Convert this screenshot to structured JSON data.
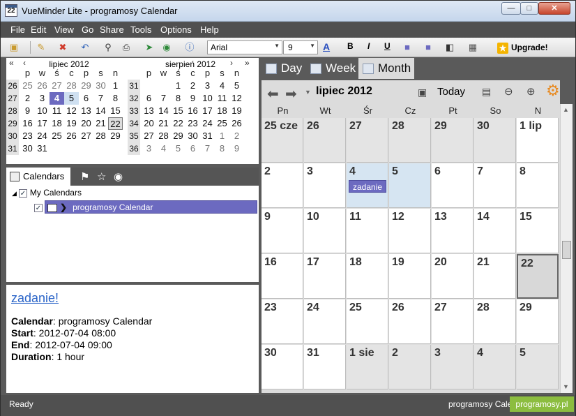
{
  "window": {
    "title": "VueMinder Lite - programosy Calendar",
    "icon_text": "22"
  },
  "menu": [
    "File",
    "Edit",
    "View",
    "Go",
    "Share",
    "Tools",
    "Options",
    "Help"
  ],
  "toolbar": {
    "font": "Arial",
    "size": "9",
    "bold": "B",
    "italic": "I",
    "underline": "U",
    "upgrade": "Upgrade!"
  },
  "minical": {
    "left": {
      "title": "lipiec 2012",
      "daynames": [
        "p",
        "w",
        "ś",
        "c",
        "p",
        "s",
        "n"
      ],
      "weeks": [
        {
          "wk": "26",
          "days": [
            "25",
            "26",
            "27",
            "28",
            "29",
            "30",
            "1"
          ]
        },
        {
          "wk": "27",
          "days": [
            "2",
            "3",
            "4",
            "5",
            "6",
            "7",
            "8"
          ]
        },
        {
          "wk": "28",
          "days": [
            "9",
            "10",
            "11",
            "12",
            "13",
            "14",
            "15"
          ]
        },
        {
          "wk": "29",
          "days": [
            "16",
            "17",
            "18",
            "19",
            "20",
            "21",
            "22"
          ]
        },
        {
          "wk": "30",
          "days": [
            "23",
            "24",
            "25",
            "26",
            "27",
            "28",
            "29"
          ]
        },
        {
          "wk": "31",
          "days": [
            "30",
            "31",
            "",
            "",
            "",
            "",
            ""
          ]
        }
      ]
    },
    "right": {
      "title": "sierpień 2012",
      "daynames": [
        "p",
        "w",
        "ś",
        "c",
        "p",
        "s",
        "n"
      ],
      "weeks": [
        {
          "wk": "31",
          "days": [
            "",
            "",
            "1",
            "2",
            "3",
            "4",
            "5"
          ]
        },
        {
          "wk": "32",
          "days": [
            "6",
            "7",
            "8",
            "9",
            "10",
            "11",
            "12"
          ]
        },
        {
          "wk": "33",
          "days": [
            "13",
            "14",
            "15",
            "16",
            "17",
            "18",
            "19"
          ]
        },
        {
          "wk": "34",
          "days": [
            "20",
            "21",
            "22",
            "23",
            "24",
            "25",
            "26"
          ]
        },
        {
          "wk": "35",
          "days": [
            "27",
            "28",
            "29",
            "30",
            "31",
            "1",
            "2"
          ]
        },
        {
          "wk": "36",
          "days": [
            "3",
            "4",
            "5",
            "6",
            "7",
            "8",
            "9"
          ]
        }
      ]
    }
  },
  "calendars_tab": {
    "label": "Calendars"
  },
  "tree": {
    "root": "My Calendars",
    "child": "programosy Calendar"
  },
  "details": {
    "title": "zadanie!",
    "calendar_label": "Calendar",
    "calendar_value": ": programosy Calendar",
    "start_label": "Start",
    "start_value": ": 2012-07-04 08:00",
    "end_label": "End",
    "end_value": ": 2012-07-04 09:00",
    "duration_label": "Duration",
    "duration_value": ": 1 hour"
  },
  "view_tabs": [
    "Day",
    "Week",
    "Month"
  ],
  "month_view": {
    "title": "lipiec 2012",
    "today_label": "Today",
    "daynames": [
      "Pn",
      "Wt",
      "Śr",
      "Cz",
      "Pt",
      "So",
      "N"
    ],
    "weeks": [
      [
        "25 cze",
        "26",
        "27",
        "28",
        "29",
        "30",
        "1 lip"
      ],
      [
        "2",
        "3",
        "4",
        "5",
        "6",
        "7",
        "8"
      ],
      [
        "9",
        "10",
        "11",
        "12",
        "13",
        "14",
        "15"
      ],
      [
        "16",
        "17",
        "18",
        "19",
        "20",
        "21",
        "22"
      ],
      [
        "23",
        "24",
        "25",
        "26",
        "27",
        "28",
        "29"
      ],
      [
        "30",
        "31",
        "1 sie",
        "2",
        "3",
        "4",
        "5"
      ]
    ],
    "event": {
      "label": "zadanie"
    }
  },
  "status": {
    "left": "Ready",
    "right": "programosy Calendar"
  },
  "watermark": "programosy.pl"
}
